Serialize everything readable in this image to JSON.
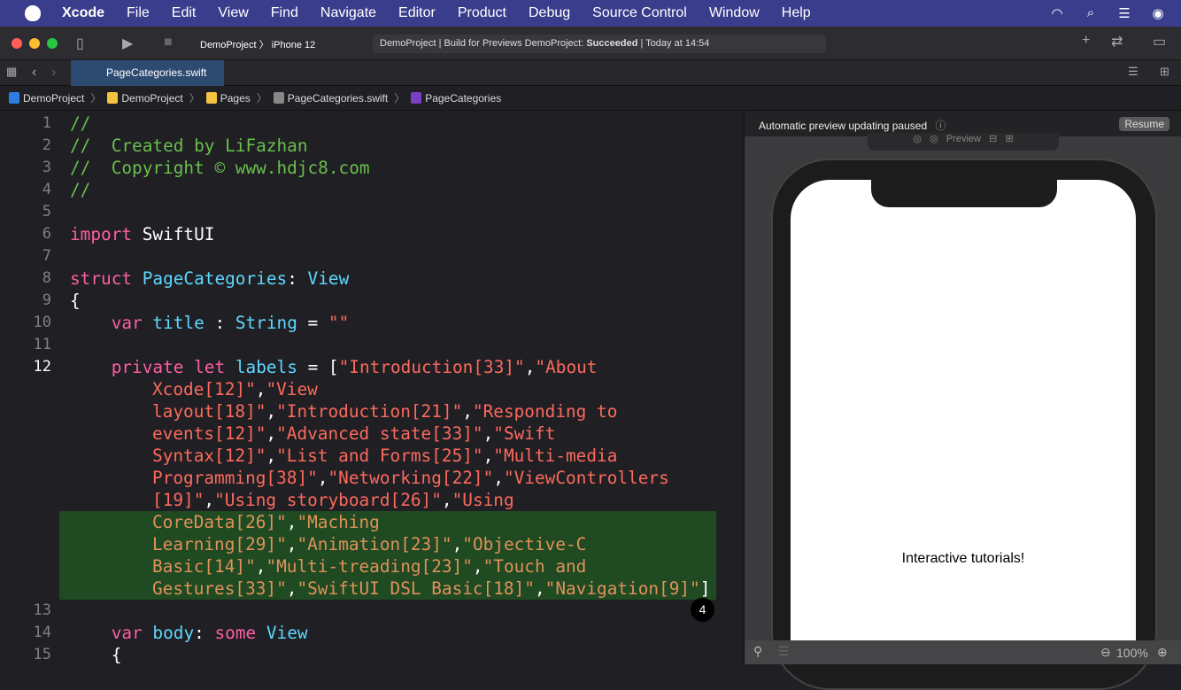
{
  "menubar": {
    "items": [
      "Xcode",
      "File",
      "Edit",
      "View",
      "Find",
      "Navigate",
      "Editor",
      "Product",
      "Debug",
      "Source Control",
      "Window",
      "Help"
    ]
  },
  "toolbar": {
    "scheme": "DemoProject",
    "device": "iPhone 12",
    "status_prefix": "DemoProject | Build for Previews DemoProject: ",
    "status_result": "Succeeded",
    "status_time": " | Today at 14:54"
  },
  "tab": {
    "label": "PageCategories.swift"
  },
  "breadcrumb": [
    "DemoProject",
    "DemoProject",
    "Pages",
    "PageCategories.swift",
    "PageCategories"
  ],
  "editor": {
    "badge": "4",
    "lines": [
      {
        "n": "1",
        "tk": [
          [
            "c",
            "//"
          ]
        ]
      },
      {
        "n": "2",
        "tk": [
          [
            "c",
            "//  Created by LiFazhan"
          ]
        ]
      },
      {
        "n": "3",
        "tk": [
          [
            "c",
            "//  Copyright © www.hdjc8.com"
          ]
        ]
      },
      {
        "n": "4",
        "tk": [
          [
            "c",
            "//"
          ]
        ]
      },
      {
        "n": "5",
        "tk": []
      },
      {
        "n": "6",
        "tk": [
          [
            "k",
            "import"
          ],
          [
            "p",
            " SwiftUI"
          ]
        ]
      },
      {
        "n": "7",
        "tk": []
      },
      {
        "n": "8",
        "tk": [
          [
            "k",
            "struct"
          ],
          [
            "p",
            " "
          ],
          [
            "t",
            "PageCategories"
          ],
          [
            "p",
            ": "
          ],
          [
            "t",
            "View"
          ]
        ]
      },
      {
        "n": "9",
        "tk": [
          [
            "p",
            "{"
          ]
        ]
      },
      {
        "n": "10",
        "tk": [
          [
            "p",
            "    "
          ],
          [
            "k",
            "var"
          ],
          [
            "p",
            " "
          ],
          [
            "id",
            "title"
          ],
          [
            "p",
            " : "
          ],
          [
            "t",
            "String"
          ],
          [
            "p",
            " = "
          ],
          [
            "s",
            "\"\""
          ]
        ]
      },
      {
        "n": "11",
        "tk": []
      },
      {
        "n": "12",
        "cur": true,
        "tk": [
          [
            "p",
            "    "
          ],
          [
            "k",
            "private"
          ],
          [
            "p",
            " "
          ],
          [
            "k",
            "let"
          ],
          [
            "p",
            " "
          ],
          [
            "id",
            "labels"
          ],
          [
            "p",
            " = ["
          ],
          [
            "s",
            "\"Introduction[33]\""
          ],
          [
            "p",
            ","
          ],
          [
            "s",
            "\"About"
          ]
        ]
      },
      {
        "n": "",
        "w": true,
        "tk": [
          [
            "s",
            "Xcode[12]\""
          ],
          [
            "p",
            ","
          ],
          [
            "s",
            "\"View"
          ]
        ]
      },
      {
        "n": "",
        "w": true,
        "tk": [
          [
            "s",
            "layout[18]\""
          ],
          [
            "p",
            ","
          ],
          [
            "s",
            "\"Introduction[21]\""
          ],
          [
            "p",
            ","
          ],
          [
            "s",
            "\"Responding to"
          ]
        ]
      },
      {
        "n": "",
        "w": true,
        "tk": [
          [
            "s",
            "events[12]\""
          ],
          [
            "p",
            ","
          ],
          [
            "s",
            "\"Advanced state[33]\""
          ],
          [
            "p",
            ","
          ],
          [
            "s",
            "\"Swift"
          ]
        ]
      },
      {
        "n": "",
        "w": true,
        "tk": [
          [
            "s",
            "Syntax[12]\""
          ],
          [
            "p",
            ","
          ],
          [
            "s",
            "\"List and Forms[25]\""
          ],
          [
            "p",
            ","
          ],
          [
            "s",
            "\"Multi-media"
          ]
        ]
      },
      {
        "n": "",
        "w": true,
        "tk": [
          [
            "s",
            "Programming[38]\""
          ],
          [
            "p",
            ","
          ],
          [
            "s",
            "\"Networking[22]\""
          ],
          [
            "p",
            ","
          ],
          [
            "s",
            "\"ViewControllers"
          ]
        ]
      },
      {
        "n": "",
        "w": true,
        "tk": [
          [
            "s",
            "[19]\""
          ],
          [
            "p",
            ","
          ],
          [
            "s",
            "\"Using storyboard[26]\""
          ],
          [
            "p",
            ","
          ],
          [
            "s",
            "\"Using"
          ]
        ]
      },
      {
        "n": "",
        "w": true,
        "hl": true,
        "tk": [
          [
            "s",
            "CoreData[26]\""
          ],
          [
            "p",
            ","
          ],
          [
            "s",
            "\"Maching"
          ]
        ]
      },
      {
        "n": "",
        "w": true,
        "hl": true,
        "tk": [
          [
            "s",
            "Learning[29]\""
          ],
          [
            "p",
            ","
          ],
          [
            "s",
            "\"Animation[23]\""
          ],
          [
            "p",
            ","
          ],
          [
            "s",
            "\"Objective-C"
          ]
        ]
      },
      {
        "n": "",
        "w": true,
        "hl": true,
        "tk": [
          [
            "s",
            "Basic[14]\""
          ],
          [
            "p",
            ","
          ],
          [
            "s",
            "\"Multi-treading[23]\""
          ],
          [
            "p",
            ","
          ],
          [
            "s",
            "\"Touch and"
          ]
        ]
      },
      {
        "n": "",
        "w": true,
        "hl": true,
        "tk": [
          [
            "s",
            "Gestures[33]\""
          ],
          [
            "p",
            ","
          ],
          [
            "s",
            "\"SwiftUI DSL Basic[18]\""
          ],
          [
            "p",
            ","
          ],
          [
            "s",
            "\"Navigation[9]\""
          ],
          [
            "p",
            "]"
          ]
        ]
      },
      {
        "n": "13",
        "tk": []
      },
      {
        "n": "14",
        "tk": [
          [
            "p",
            "    "
          ],
          [
            "k",
            "var"
          ],
          [
            "p",
            " "
          ],
          [
            "id",
            "body"
          ],
          [
            "p",
            ": "
          ],
          [
            "k",
            "some"
          ],
          [
            "p",
            " "
          ],
          [
            "t",
            "View"
          ]
        ]
      },
      {
        "n": "15",
        "tk": [
          [
            "p",
            "    {"
          ]
        ]
      }
    ]
  },
  "preview": {
    "banner": "Automatic preview updating paused",
    "resume": "Resume",
    "tools_label": "Preview",
    "text": "Interactive tutorials!",
    "zoom": "100%"
  }
}
